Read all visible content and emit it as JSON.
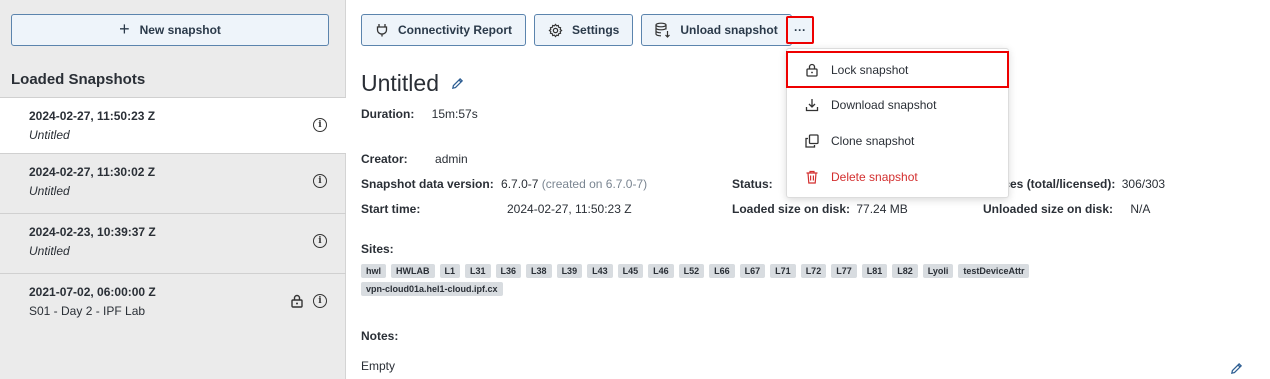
{
  "sidebar": {
    "new_button": "New snapshot",
    "title": "Loaded Snapshots",
    "items": [
      {
        "date": "2024-02-27, 11:50:23 Z",
        "name": "Untitled"
      },
      {
        "date": "2024-02-27, 11:30:02 Z",
        "name": "Untitled"
      },
      {
        "date": "2024-02-23, 10:39:37 Z",
        "name": "Untitled"
      },
      {
        "date": "2021-07-02, 06:00:00 Z",
        "name": "S01 - Day 2 - IPF Lab"
      }
    ]
  },
  "toolbar": {
    "connectivity": "Connectivity Report",
    "settings": "Settings",
    "unload": "Unload snapshot",
    "more": "···"
  },
  "menu": {
    "lock": "Lock snapshot",
    "download": "Download snapshot",
    "clone": "Clone snapshot",
    "delete": "Delete snapshot"
  },
  "details": {
    "title": "Untitled",
    "duration_label": "Duration:",
    "duration": "15m:57s",
    "creator_label": "Creator:",
    "creator": "admin",
    "version_label": "Snapshot data version:",
    "version": "6.7.0-7",
    "version_note": "(created on 6.7.0-7)",
    "start_label": "Start time:",
    "start": "2024-02-27, 11:50:23 Z",
    "status_label": "Status:",
    "loaded_label": "Loaded size on disk:",
    "loaded": "77.24 MB",
    "devices_label": "ices (total/licensed):",
    "devices": "306/303",
    "unloaded_label": "Unloaded size on disk:",
    "unloaded": "N/A",
    "sites_label": "Sites:",
    "sites": [
      "hwl",
      "HWLAB",
      "L1",
      "L31",
      "L36",
      "L38",
      "L39",
      "L43",
      "L45",
      "L46",
      "L52",
      "L66",
      "L67",
      "L71",
      "L72",
      "L77",
      "L81",
      "L82",
      "Lyoli",
      "testDeviceAttr",
      "vpn-cloud01a.hel1-cloud.ipf.cx"
    ],
    "notes_label": "Notes:",
    "notes": "Empty"
  },
  "colors": {
    "accent_border": "#5b84ad",
    "highlight": "#ee0000",
    "danger": "#d32f2f"
  }
}
